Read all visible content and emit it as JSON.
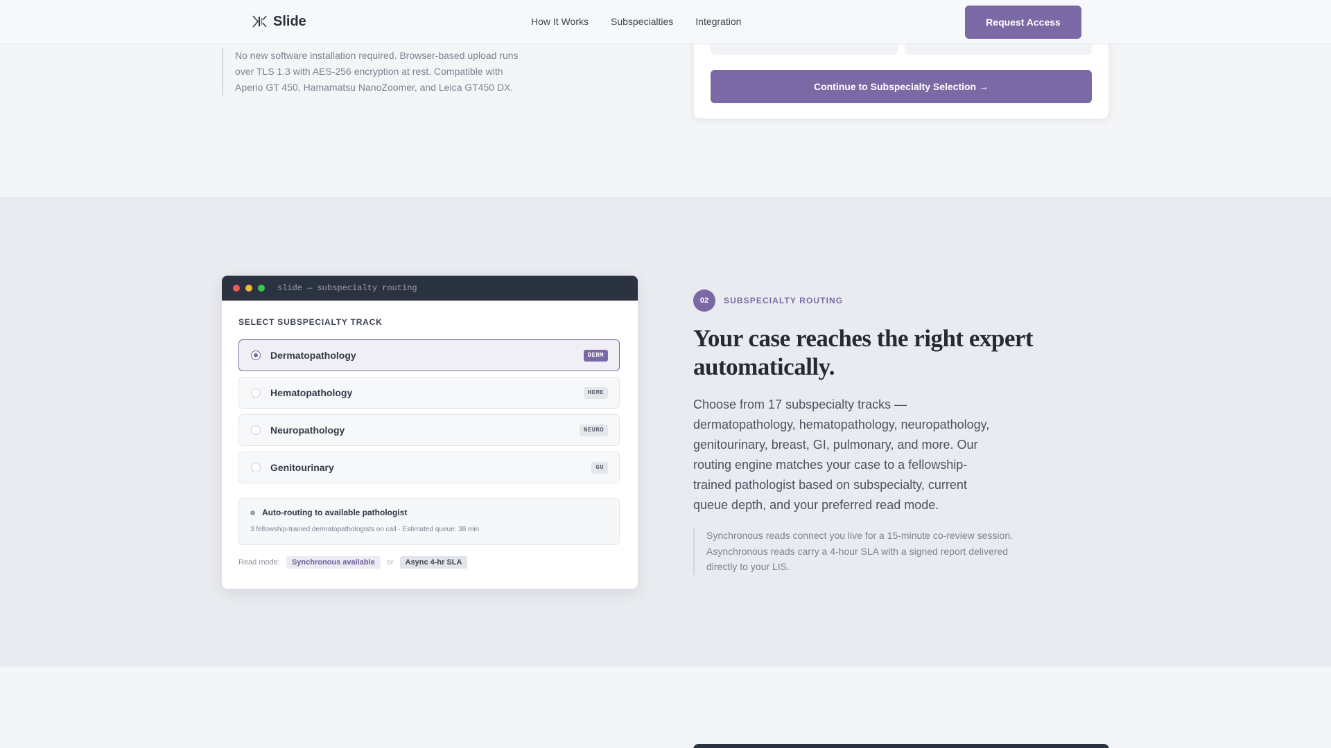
{
  "header": {
    "brand": "Slide",
    "nav": [
      "How It Works",
      "Subspecialties",
      "Integration"
    ],
    "cta": "Request Access"
  },
  "previous_step": {
    "note": "No new software installation required. Browser-based upload runs over TLS 1.3 with AES-256 encryption at rest. Compatible with Aperio GT 450, Hamamatsu NanoZoomer, and Leica GT450 DX.",
    "continue_label": "Continue to Subspecialty Selection →"
  },
  "routing_window": {
    "title": "slide — subspecialty routing",
    "section_label": "SELECT SUBSPECIALTY TRACK",
    "tracks": [
      {
        "name": "Dermatopathology",
        "badge": "DERM",
        "selected": true
      },
      {
        "name": "Hematopathology",
        "badge": "HEME",
        "selected": false
      },
      {
        "name": "Neuropathology",
        "badge": "NEURO",
        "selected": false
      },
      {
        "name": "Genitourinary",
        "badge": "GU",
        "selected": false
      }
    ],
    "auto_routing": {
      "title": "Auto-routing to available pathologist",
      "subtitle": "3 fellowship-trained dermatopathologists on call · Estimated queue: 38 min"
    },
    "read_mode": {
      "label": "Read mode:",
      "sync": "Synchronous available",
      "or": "or",
      "async": "Async 4-hr SLA"
    }
  },
  "step": {
    "number": "02",
    "label": "SUBSPECIALTY ROUTING",
    "headline": "Your case reaches the right expert automatically.",
    "body": "Choose from 17 subspecialty tracks — dermatopathology, hematopathology, neuropathology, genitourinary, breast, GI, pulmonary, and more. Our routing engine matches your case to a fellowship-trained pathologist based on subspecialty, current queue depth, and your preferred read mode.",
    "note": "Synchronous reads connect you live for a 15-minute co-review session. Asynchronous reads carry a 4-hour SLA with a signed report delivered directly to your LIS."
  },
  "colors": {
    "accent": "#7b69a6",
    "dark": "#2b3240"
  }
}
